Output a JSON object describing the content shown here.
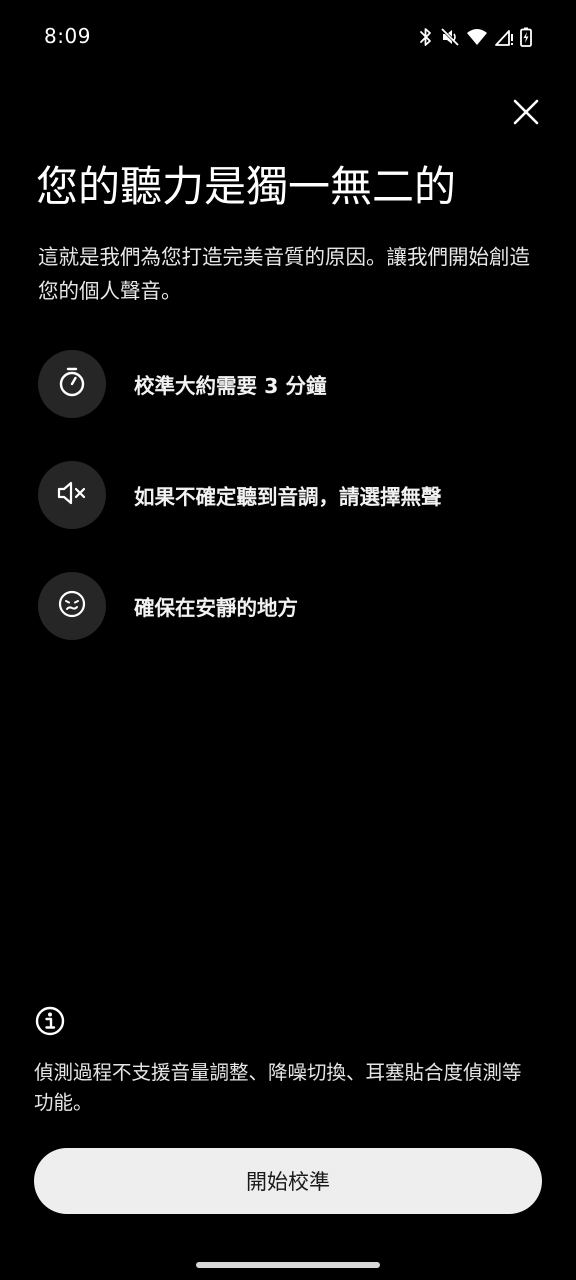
{
  "status_bar": {
    "time": "8:09",
    "icons": [
      "bluetooth-icon",
      "mute-icon",
      "wifi-icon",
      "cell-signal-icon",
      "battery-charging-icon"
    ]
  },
  "header": {
    "close_icon": "close-icon"
  },
  "main": {
    "title": "您的聽力是獨一無二的",
    "description": "這就是我們為您打造完美音質的原因。讓我們開始創造您的個人聲音。",
    "tips": [
      {
        "icon": "timer-icon",
        "text": "校準大約需要 3 分鐘"
      },
      {
        "icon": "speaker-muted-icon",
        "text": "如果不確定聽到音調，請選擇無聲"
      },
      {
        "icon": "quiet-face-icon",
        "text": "確保在安靜的地方"
      }
    ]
  },
  "footer": {
    "info_icon": "info-icon",
    "note": "偵測過程不支援音量調整、降噪切換、耳塞貼合度偵測等功能。",
    "start_button_label": "開始校準"
  },
  "colors": {
    "background": "#000000",
    "text": "#ffffff",
    "icon_circle": "#262626",
    "button_bg": "#eeeeee",
    "button_text": "#1a1a1a"
  }
}
